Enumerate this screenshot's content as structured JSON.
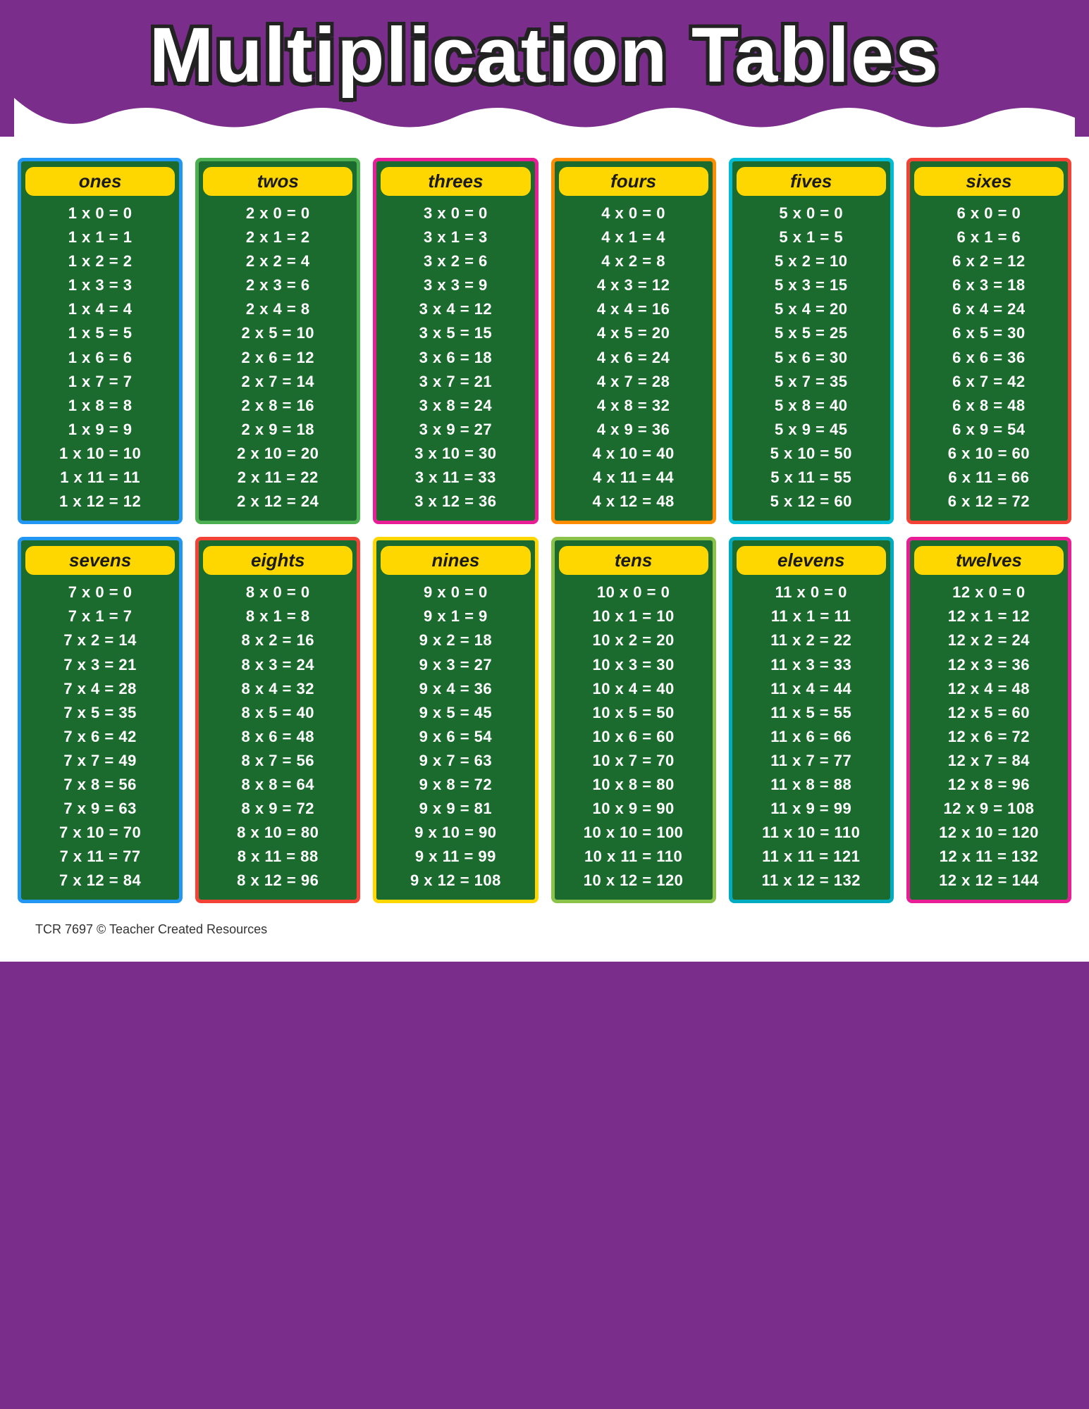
{
  "title": "Multiplication Tables",
  "footer": "TCR 7697  © Teacher Created Resources",
  "tables": [
    {
      "label": "ones",
      "border": "blue",
      "rows": [
        "1x0=0",
        "1x1=1",
        "1x2=2",
        "1x3=3",
        "1x4=4",
        "1x5=5",
        "1x6=6",
        "1x7=7",
        "1x8=8",
        "1x9=9",
        "1x10=10",
        "1x11=11",
        "1x12=12"
      ]
    },
    {
      "label": "twos",
      "border": "green",
      "rows": [
        "2x0=0",
        "2x1=2",
        "2x2=4",
        "2x3=6",
        "2x4=8",
        "2x5=10",
        "2x6=12",
        "2x7=14",
        "2x8=16",
        "2x9=18",
        "2x10=20",
        "2x11=22",
        "2x12=24"
      ]
    },
    {
      "label": "threes",
      "border": "pink",
      "rows": [
        "3x0=0",
        "3x1=3",
        "3x2=6",
        "3x3=9",
        "3x4=12",
        "3x5=15",
        "3x6=18",
        "3x7=21",
        "3x8=24",
        "3x9=27",
        "3x10=30",
        "3x11=33",
        "3x12=36"
      ]
    },
    {
      "label": "fours",
      "border": "orange",
      "rows": [
        "4x0=0",
        "4x1=4",
        "4x2=8",
        "4x3=12",
        "4x4=16",
        "4x5=20",
        "4x6=24",
        "4x7=28",
        "4x8=32",
        "4x9=36",
        "4x10=40",
        "4x11=44",
        "4x12=48"
      ]
    },
    {
      "label": "fives",
      "border": "teal",
      "rows": [
        "5x0=0",
        "5x1=5",
        "5x2=10",
        "5x3=15",
        "5x4=20",
        "5x5=25",
        "5x6=30",
        "5x7=35",
        "5x8=40",
        "5x9=45",
        "5x10=50",
        "5x11=55",
        "5x12=60"
      ]
    },
    {
      "label": "sixes",
      "border": "red",
      "rows": [
        "6x0=0",
        "6x1=6",
        "6x2=12",
        "6x3=18",
        "6x4=24",
        "6x5=30",
        "6x6=36",
        "6x7=42",
        "6x8=48",
        "6x9=54",
        "6x10=60",
        "6x11=66",
        "6x12=72"
      ]
    },
    {
      "label": "sevens",
      "border": "blue",
      "rows": [
        "7x0=0",
        "7x1=7",
        "7x2=14",
        "7x3=21",
        "7x4=28",
        "7x5=35",
        "7x6=42",
        "7x7=49",
        "7x8=56",
        "7x9=63",
        "7x10=70",
        "7x11=77",
        "7x12=84"
      ]
    },
    {
      "label": "eights",
      "border": "red",
      "rows": [
        "8x0=0",
        "8x1=8",
        "8x2=16",
        "8x3=24",
        "8x4=32",
        "8x5=40",
        "8x6=48",
        "8x7=56",
        "8x8=64",
        "8x9=72",
        "8x10=80",
        "8x11=88",
        "8x12=96"
      ]
    },
    {
      "label": "nines",
      "border": "yellow-border",
      "rows": [
        "9x0=0",
        "9x1=9",
        "9x2=18",
        "9x3=27",
        "9x4=36",
        "9x5=45",
        "9x6=54",
        "9x7=63",
        "9x8=72",
        "9x9=81",
        "9x10=90",
        "9x11=99",
        "9x12=108"
      ]
    },
    {
      "label": "tens",
      "border": "lime",
      "rows": [
        "10x0=0",
        "10x1=10",
        "10x2=20",
        "10x3=30",
        "10x4=40",
        "10x5=50",
        "10x6=60",
        "10x7=70",
        "10x8=80",
        "10x9=90",
        "10x10=100",
        "10x11=110",
        "10x12=120"
      ]
    },
    {
      "label": "elevens",
      "border": "cyan",
      "rows": [
        "11x0=0",
        "11x1=11",
        "11x2=22",
        "11x3=33",
        "11x4=44",
        "11x5=55",
        "11x6=66",
        "11x7=77",
        "11x8=88",
        "11x9=99",
        "11x10=110",
        "11x11=121",
        "11x12=132"
      ]
    },
    {
      "label": "twelves",
      "border": "pink",
      "rows": [
        "12x0=0",
        "12x1=12",
        "12x2=24",
        "12x3=36",
        "12x4=48",
        "12x5=60",
        "12x6=72",
        "12x7=84",
        "12x8=96",
        "12x9=108",
        "12x10=120",
        "12x11=132",
        "12x12=144"
      ]
    }
  ]
}
